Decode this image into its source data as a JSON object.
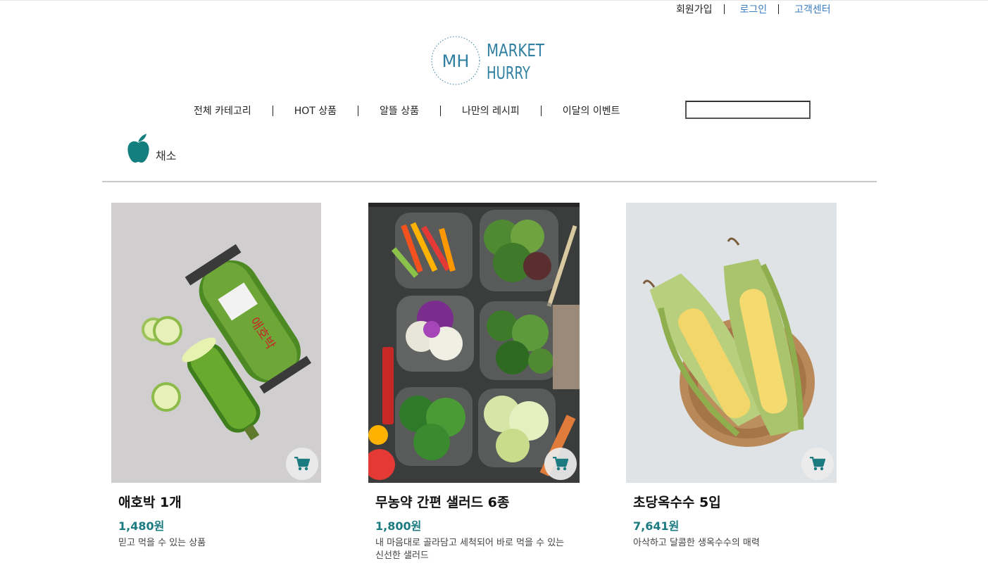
{
  "header": {
    "top_links": {
      "signup": "회원가입",
      "login": "로그인",
      "help": "고객센터"
    },
    "logo": {
      "mark": "MH",
      "line1": "MARKET",
      "line2": "HURRY"
    }
  },
  "nav": {
    "items": [
      "전체 카테고리",
      "HOT 상품",
      "알뜰 상품",
      "나만의 레시피",
      "이달의 이벤트"
    ],
    "search_value": ""
  },
  "category": {
    "label": "채소",
    "icon": "apple-icon"
  },
  "colors": {
    "accent": "#1c7b80",
    "link": "#3d7ebf",
    "apple": "#137f7e"
  },
  "products": [
    {
      "name": "애호박 1개",
      "price": "1,480원",
      "desc": "믿고 먹을 수 있는 상품",
      "image": "zucchini-image"
    },
    {
      "name": "무농약 간편 샐러드 6종",
      "price": "1,800원",
      "desc": "내 마음대로 골라담고 세척되어 바로 먹을 수 있는 신선한 샐러드",
      "image": "salad-image"
    },
    {
      "name": "초당옥수수 5입",
      "price": "7,641원",
      "desc": "아삭하고 달콤한 생옥수수의 매력",
      "image": "corn-image"
    }
  ]
}
